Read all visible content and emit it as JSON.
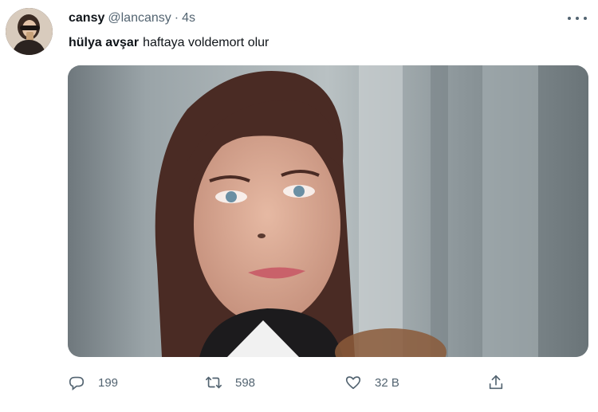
{
  "tweet": {
    "display_name": "cansy",
    "handle": "@lancansy",
    "separator": "·",
    "time": "4s",
    "mention": "hülya avşar",
    "text": "haftaya voldemort olur",
    "counts": {
      "replies": "199",
      "retweets": "598",
      "likes": "32 B"
    }
  },
  "icons": {
    "more": "more-horizontal-icon",
    "reply": "reply-bubble-icon",
    "retweet": "retweet-icon",
    "like": "heart-icon",
    "share": "share-icon"
  },
  "colors": {
    "text_primary": "#0f1419",
    "text_secondary": "#536471"
  }
}
